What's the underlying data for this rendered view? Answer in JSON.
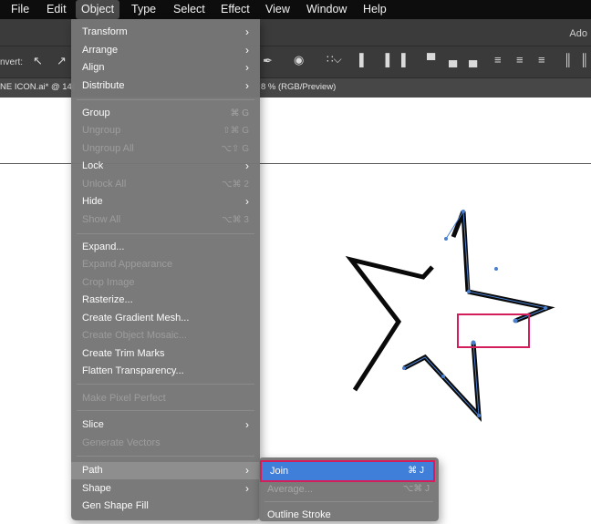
{
  "menubar": {
    "items": [
      "File",
      "Edit",
      "Object",
      "Type",
      "Select",
      "Effect",
      "View",
      "Window",
      "Help"
    ]
  },
  "control_bar": {
    "convert_label": "nvert:",
    "app_label": "Ado"
  },
  "document": {
    "tab_left": "NE ICON.ai* @ 14(",
    "tab_right": "8 % (RGB/Preview)"
  },
  "object_menu": {
    "items": [
      {
        "label": "Transform",
        "submenu": true
      },
      {
        "label": "Arrange",
        "submenu": true
      },
      {
        "label": "Align",
        "submenu": true
      },
      {
        "label": "Distribute",
        "submenu": true
      },
      {
        "label": "Group",
        "shortcut": "⌘ G"
      },
      {
        "label": "Ungroup",
        "shortcut": "⇧⌘ G",
        "disabled": true
      },
      {
        "label": "Ungroup All",
        "shortcut": "⌥⇧ G",
        "disabled": true
      },
      {
        "label": "Lock",
        "submenu": true
      },
      {
        "label": "Unlock All",
        "shortcut": "⌥⌘ 2",
        "disabled": true
      },
      {
        "label": "Hide",
        "submenu": true
      },
      {
        "label": "Show All",
        "shortcut": "⌥⌘ 3",
        "disabled": true
      },
      {
        "label": "Expand..."
      },
      {
        "label": "Expand Appearance",
        "disabled": true
      },
      {
        "label": "Crop Image",
        "disabled": true
      },
      {
        "label": "Rasterize..."
      },
      {
        "label": "Create Gradient Mesh..."
      },
      {
        "label": "Create Object Mosaic...",
        "disabled": true
      },
      {
        "label": "Create Trim Marks"
      },
      {
        "label": "Flatten Transparency..."
      },
      {
        "label": "Make Pixel Perfect",
        "disabled": true
      },
      {
        "label": "Slice",
        "submenu": true
      },
      {
        "label": "Generate Vectors",
        "disabled": true
      },
      {
        "label": "Path",
        "submenu": true,
        "highlighted": true
      },
      {
        "label": "Shape",
        "submenu": true
      },
      {
        "label": "Gen Shape Fill"
      }
    ]
  },
  "path_submenu": {
    "items": [
      {
        "label": "Join",
        "shortcut": "⌘ J",
        "selected": true
      },
      {
        "label": "Average...",
        "shortcut": "⌥⌘ J",
        "disabled": true
      },
      {
        "label": "Outline Stroke"
      }
    ]
  },
  "colors": {
    "menu_bg": "#767676",
    "highlight_blue": "#3f7fd9",
    "annotation_red": "#d41e5c",
    "anchor_blue": "#4a7fd0"
  },
  "icons": [
    "direct-select-icon",
    "convert-anchor-icon",
    "align-left-icon",
    "align-center-icon",
    "align-right-icon",
    "distribute-icon"
  ]
}
